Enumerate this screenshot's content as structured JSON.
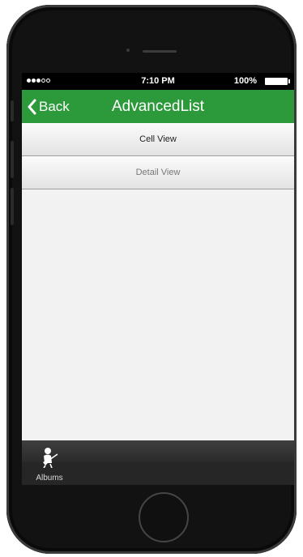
{
  "statusbar": {
    "time": "7:10 PM",
    "battery": "100%"
  },
  "navbar": {
    "back_label": "Back",
    "title": "AdvancedList",
    "color": "#2c9a3a"
  },
  "list": {
    "items": [
      {
        "label": "Cell View"
      },
      {
        "label": "Detail View"
      }
    ]
  },
  "tabbar": {
    "items": [
      {
        "label": "Albums",
        "icon": "guitar-player-icon"
      }
    ]
  }
}
